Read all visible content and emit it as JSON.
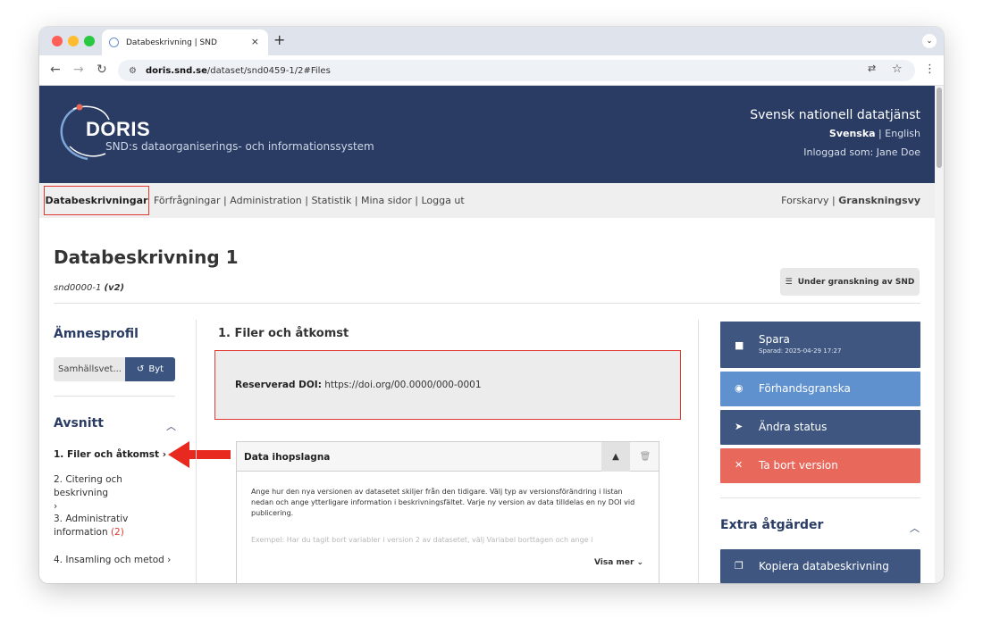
{
  "browser": {
    "tab_title": "Databeskrivning | SND",
    "tab_close": "×",
    "new_tab": "+",
    "url_host": "doris.snd.se",
    "url_path": "/dataset/snd0459-1/2#Files"
  },
  "header": {
    "logo_text": "DORIS",
    "subtitle": "SND:s dataorganiserings- och informationssystem",
    "org_name": "Svensk nationell datatjänst",
    "lang_active": "Svenska",
    "lang_separator": " | ",
    "lang_other": "English",
    "logged_in": "Inloggad som: Jane Doe"
  },
  "nav": {
    "active": "Databeskrivningar",
    "rest": "Förfrågningar | Administration | Statistik | Mina sidor | Logga ut",
    "view_draft": "Forskarvy",
    "view_separator": " | ",
    "view_review": "Granskningsvy"
  },
  "page": {
    "title": "Databeskrivning 1",
    "id_text": "snd0000-1 ",
    "id_version": "(v2)",
    "review_badge": "Under granskning av SND"
  },
  "sidebar": {
    "profile_heading": "Ämnesprofil",
    "profile_value": "Samhällsvet...",
    "change_button": "Byt",
    "sections_heading": "Avsnitt",
    "sections": [
      {
        "label": "1. Filer och åtkomst",
        "suffix": " ›"
      },
      {
        "label": "2. Citering och beskrivning",
        "suffix": "›"
      },
      {
        "label": "3. Administrativ information",
        "count": "(2)"
      },
      {
        "label": "4. Insamling och metod",
        "suffix": " ›"
      }
    ]
  },
  "main": {
    "section_heading": "1. Filer och åtkomst",
    "doi_label": "Reserverad DOI:",
    "doi_value": "https://doi.org/00.0000/000-0001",
    "panel_title": "Data ihopslagna",
    "panel_description": "Ange hur den nya versionen av datasetet skiljer från den tidigare. Välj typ av versionsförändring i listan nedan och ange ytterligare information i beskrivningsfältet. Varje ny version av data tilldelas en ny DOI vid publicering.",
    "panel_example": "Exempel: Har du tagit bort variabler i version 2 av datasetet, välj Variabel borttagen och ange i",
    "show_more": "Visa mer"
  },
  "actions": {
    "save": "Spara",
    "saved_at": "Sparad: 2025-04-29 17:27",
    "preview": "Förhandsgranska",
    "change_status": "Ändra status",
    "delete_version": "Ta bort version",
    "extra_heading": "Extra åtgärder",
    "copy": "Kopiera databeskrivning"
  },
  "colors": {
    "header_bg": "#2a3c64",
    "primary_button": "#3f5780",
    "preview_button": "#5f91cf",
    "delete_button": "#e9685c",
    "highlight_red": "#e03a32"
  }
}
